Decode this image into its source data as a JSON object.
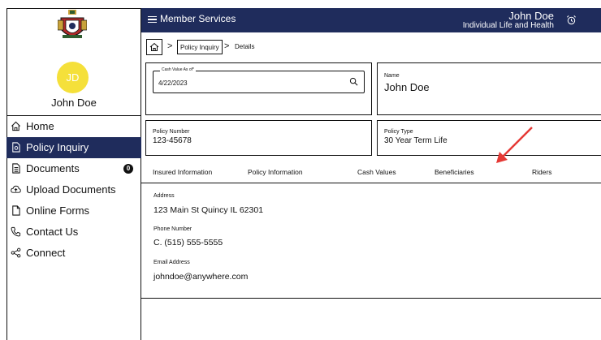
{
  "header": {
    "menu_label": "Member Services",
    "user_name": "John Doe",
    "product_line": "Individual Life and Health"
  },
  "sidebar": {
    "avatar_initials": "JD",
    "user_name": "John Doe",
    "items": [
      {
        "label": "Home",
        "icon": "home-icon"
      },
      {
        "label": "Policy Inquiry",
        "icon": "policy-icon",
        "active": true
      },
      {
        "label": "Documents",
        "icon": "document-icon",
        "badge": "0"
      },
      {
        "label": "Upload Documents",
        "icon": "cloud-upload-icon"
      },
      {
        "label": "Online Forms",
        "icon": "form-icon"
      },
      {
        "label": "Contact Us",
        "icon": "phone-icon"
      },
      {
        "label": "Connect",
        "icon": "share-icon"
      }
    ]
  },
  "breadcrumb": {
    "policy_inquiry": "Policy Inquiry",
    "separator": ">",
    "details": "Details"
  },
  "cash_value": {
    "label": "Cash Value As of*",
    "date": "4/22/2023"
  },
  "name_card": {
    "label": "Name",
    "value": "John Doe"
  },
  "policy_number": {
    "label": "Policy Number",
    "value": "123-45678"
  },
  "policy_type": {
    "label": "Policy Type",
    "value": "30 Year Term Life"
  },
  "tabs": [
    "Insured Information",
    "Policy Information",
    "Cash Values",
    "Beneficiaries",
    "Riders"
  ],
  "insured": {
    "address_label": "Address",
    "address": "123 Main St Quincy IL 62301",
    "phone_label": "Phone Number",
    "phone": "C. (515) 555-5555",
    "email_label": "Email Address",
    "email": "johndoe@anywhere.com"
  },
  "colors": {
    "header": "#1f2c5c",
    "avatar": "#f5e03a",
    "annotation_arrow": "#e53935"
  }
}
